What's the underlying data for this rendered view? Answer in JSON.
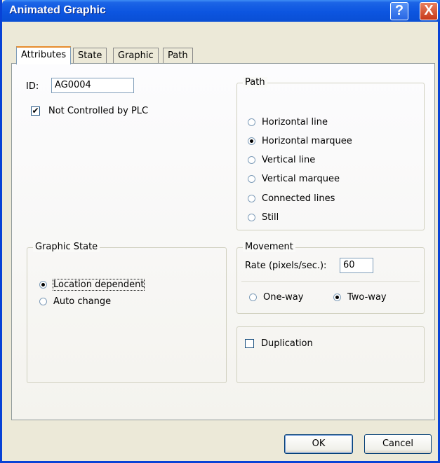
{
  "window": {
    "title": "Animated Graphic",
    "help_label": "?",
    "close_label": "X"
  },
  "tabs": [
    {
      "label": "Attributes",
      "active": true
    },
    {
      "label": "State",
      "active": false
    },
    {
      "label": "Graphic",
      "active": false
    },
    {
      "label": "Path",
      "active": false
    }
  ],
  "attributes": {
    "id_label": "ID:",
    "id_value": "AG0004",
    "not_controlled_label": "Not Controlled by PLC",
    "not_controlled_checked": true,
    "check_mark": "✔"
  },
  "graphic_state": {
    "title": "Graphic State",
    "options": [
      {
        "label": "Location dependent",
        "selected": true
      },
      {
        "label": "Auto change",
        "selected": false
      }
    ]
  },
  "path": {
    "title": "Path",
    "options": [
      {
        "label": "Horizontal line",
        "selected": false
      },
      {
        "label": "Horizontal marquee",
        "selected": true
      },
      {
        "label": "Vertical line",
        "selected": false
      },
      {
        "label": "Vertical marquee",
        "selected": false
      },
      {
        "label": "Connected lines",
        "selected": false
      },
      {
        "label": "Still",
        "selected": false
      }
    ]
  },
  "movement": {
    "title": "Movement",
    "rate_label": "Rate (pixels/sec.):",
    "rate_value": "60",
    "options": [
      {
        "label": "One-way",
        "selected": false
      },
      {
        "label": "Two-way",
        "selected": true
      }
    ]
  },
  "duplication": {
    "label": "Duplication",
    "checked": false
  },
  "buttons": {
    "ok": "OK",
    "cancel": "Cancel"
  }
}
